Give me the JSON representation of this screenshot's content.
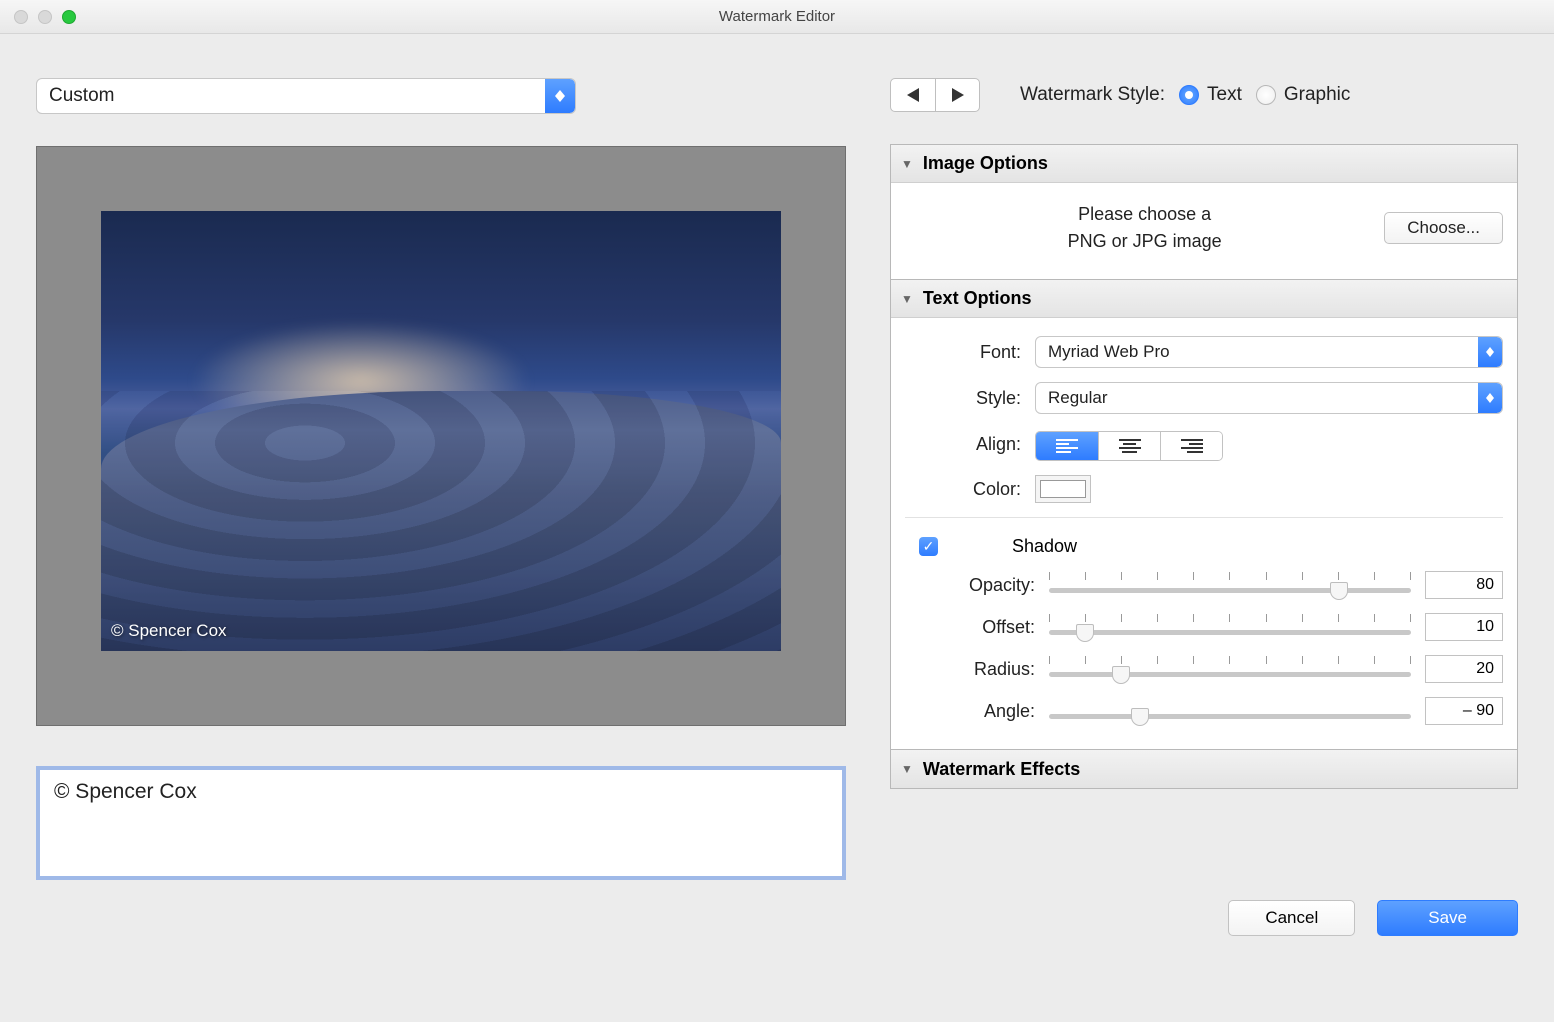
{
  "window": {
    "title": "Watermark Editor"
  },
  "preset": {
    "value": "Custom"
  },
  "watermark_style": {
    "label": "Watermark Style:",
    "text": "Text",
    "graphic": "Graphic",
    "selected": "text"
  },
  "panels": {
    "image_options": {
      "title": "Image Options",
      "hint_line1": "Please choose a",
      "hint_line2": "PNG or JPG image",
      "choose_label": "Choose..."
    },
    "text_options": {
      "title": "Text Options",
      "font_label": "Font:",
      "font_value": "Myriad Web Pro",
      "style_label": "Style:",
      "style_value": "Regular",
      "align_label": "Align:",
      "color_label": "Color:",
      "shadow_label": "Shadow",
      "shadow_checked": true,
      "opacity_label": "Opacity:",
      "opacity_value": "80",
      "offset_label": "Offset:",
      "offset_value": "10",
      "radius_label": "Radius:",
      "radius_value": "20",
      "angle_label": "Angle:",
      "angle_value": "– 90"
    },
    "watermark_effects": {
      "title": "Watermark Effects"
    }
  },
  "preview": {
    "overlay_text": "© Spencer Cox"
  },
  "input": {
    "value": "© Spencer Cox"
  },
  "footer": {
    "cancel": "Cancel",
    "save": "Save"
  }
}
